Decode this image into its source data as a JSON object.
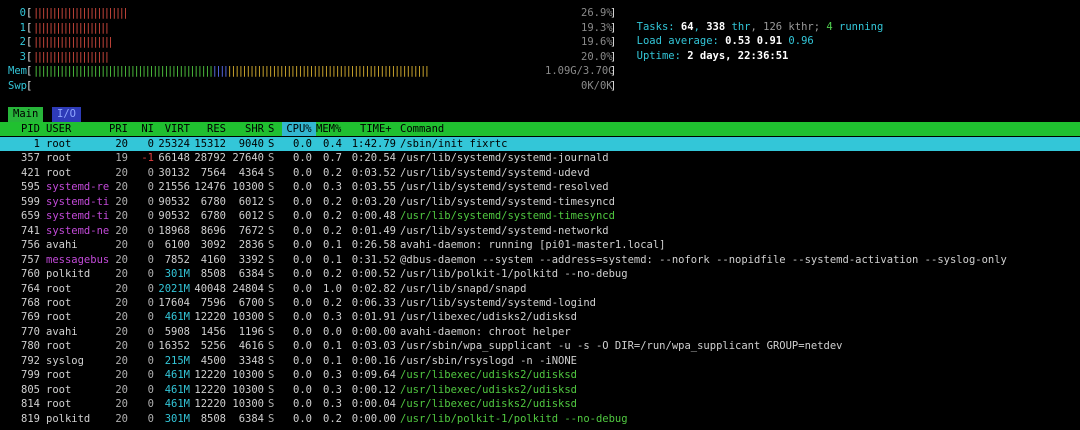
{
  "cpus": [
    {
      "label": "0",
      "bar_red": "|||||||||||||||||||||||||",
      "bar_green": "",
      "pct": "26.9%"
    },
    {
      "label": "1",
      "bar_red": "||||||||||||||||||||",
      "bar_green": "",
      "pct": "19.3%"
    },
    {
      "label": "2",
      "bar_red": "|||||||||||||||||||||",
      "bar_green": "",
      "pct": "19.6%"
    },
    {
      "label": "3",
      "bar_red": "||||||||||||||||||||",
      "bar_green": "",
      "pct": "20.0%"
    }
  ],
  "mem": {
    "label": "Mem",
    "bar_green": "||||||||||||||||||||||||||||||||||||||||||||||||",
    "bar_blue": "||||",
    "bar_yellow": "||||||||||||||||||||||||||||||||||||||||||||||||||||||",
    "value": "1.09G/3.70G"
  },
  "swp": {
    "label": "Swp",
    "value": "0K/0K"
  },
  "summary": {
    "tasks_label": "Tasks: ",
    "tasks": "64",
    "sep1": ", ",
    "thr": "338",
    "thr_label": " thr",
    "kthr": ", 126 kthr; ",
    "running": "4",
    "running_label": " running",
    "load_label": "Load average: ",
    "load1": "0.53",
    "load5": "0.91",
    "load15": "0.96",
    "uptime_label": "Uptime: ",
    "uptime": "2 days, 22:36:51"
  },
  "tabs": {
    "main": "Main",
    "io": "I/O"
  },
  "columns": {
    "pid": "PID",
    "user": "USER",
    "pri": "PRI",
    "ni": "NI",
    "virt": "VIRT",
    "res": "RES",
    "shr": "SHR",
    "s": "S",
    "cpu": "CPU%",
    "mem": "MEM%",
    "time": "TIME+",
    "command": "Command"
  },
  "processes": [
    {
      "pid": "1",
      "user": "root",
      "pri": "20",
      "ni": "0",
      "virt": "25324",
      "res": "15312",
      "shr": "9040",
      "s": "S",
      "cpu": "0.0",
      "mem": "0.4",
      "time": "1:42.79",
      "command": "/sbin/init fixrtc",
      "selected": true
    },
    {
      "pid": "357",
      "user": "root",
      "pri": "19",
      "ni": "-1",
      "virt": "66148",
      "res": "28792",
      "shr": "27640",
      "s": "S",
      "cpu": "0.0",
      "mem": "0.7",
      "time": "0:20.54",
      "command": "/usr/lib/systemd/systemd-journald"
    },
    {
      "pid": "421",
      "user": "root",
      "pri": "20",
      "ni": "0",
      "virt": "30132",
      "res": "7564",
      "shr": "4364",
      "s": "S",
      "cpu": "0.0",
      "mem": "0.2",
      "time": "0:03.52",
      "command": "/usr/lib/systemd/systemd-udevd"
    },
    {
      "pid": "595",
      "user": "systemd-re",
      "pri": "20",
      "ni": "0",
      "virt": "21556",
      "res": "12476",
      "shr": "10300",
      "s": "S",
      "cpu": "0.0",
      "mem": "0.3",
      "time": "0:03.55",
      "command": "/usr/lib/systemd/systemd-resolved",
      "mag": true
    },
    {
      "pid": "599",
      "user": "systemd-ti",
      "pri": "20",
      "ni": "0",
      "virt": "90532",
      "res": "6780",
      "shr": "6012",
      "s": "S",
      "cpu": "0.0",
      "mem": "0.2",
      "time": "0:03.20",
      "command": "/usr/lib/systemd/systemd-timesyncd",
      "mag": true
    },
    {
      "pid": "659",
      "user": "systemd-ti",
      "pri": "20",
      "ni": "0",
      "virt": "90532",
      "res": "6780",
      "shr": "6012",
      "s": "S",
      "cpu": "0.0",
      "mem": "0.2",
      "time": "0:00.48",
      "command": "/usr/lib/systemd/systemd-timesyncd",
      "mag": true,
      "green": true
    },
    {
      "pid": "741",
      "user": "systemd-ne",
      "pri": "20",
      "ni": "0",
      "virt": "18968",
      "res": "8696",
      "shr": "7672",
      "s": "S",
      "cpu": "0.0",
      "mem": "0.2",
      "time": "0:01.49",
      "command": "/usr/lib/systemd/systemd-networkd",
      "mag": true
    },
    {
      "pid": "756",
      "user": "avahi",
      "pri": "20",
      "ni": "0",
      "virt": "6100",
      "res": "3092",
      "shr": "2836",
      "s": "S",
      "cpu": "0.0",
      "mem": "0.1",
      "time": "0:26.58",
      "command": "avahi-daemon: running [pi01-master1.local]"
    },
    {
      "pid": "757",
      "user": "messagebus",
      "pri": "20",
      "ni": "0",
      "virt": "7852",
      "res": "4160",
      "shr": "3392",
      "s": "S",
      "cpu": "0.0",
      "mem": "0.1",
      "time": "0:31.52",
      "command": "@dbus-daemon --system --address=systemd: --nofork --nopidfile --systemd-activation --syslog-only",
      "mag": true
    },
    {
      "pid": "760",
      "user": "polkitd",
      "pri": "20",
      "ni": "0",
      "virt": "301M",
      "res": "8508",
      "shr": "6384",
      "s": "S",
      "cpu": "0.0",
      "mem": "0.2",
      "time": "0:00.52",
      "command": "/usr/lib/polkit-1/polkitd --no-debug"
    },
    {
      "pid": "764",
      "user": "root",
      "pri": "20",
      "ni": "0",
      "virt": "2021M",
      "res": "40048",
      "shr": "24804",
      "s": "S",
      "cpu": "0.0",
      "mem": "1.0",
      "time": "0:02.82",
      "command": "/usr/lib/snapd/snapd"
    },
    {
      "pid": "768",
      "user": "root",
      "pri": "20",
      "ni": "0",
      "virt": "17604",
      "res": "7596",
      "shr": "6700",
      "s": "S",
      "cpu": "0.0",
      "mem": "0.2",
      "time": "0:06.33",
      "command": "/usr/lib/systemd/systemd-logind"
    },
    {
      "pid": "769",
      "user": "root",
      "pri": "20",
      "ni": "0",
      "virt": "461M",
      "res": "12220",
      "shr": "10300",
      "s": "S",
      "cpu": "0.0",
      "mem": "0.3",
      "time": "0:01.91",
      "command": "/usr/libexec/udisks2/udisksd"
    },
    {
      "pid": "770",
      "user": "avahi",
      "pri": "20",
      "ni": "0",
      "virt": "5908",
      "res": "1456",
      "shr": "1196",
      "s": "S",
      "cpu": "0.0",
      "mem": "0.0",
      "time": "0:00.00",
      "command": "avahi-daemon: chroot helper"
    },
    {
      "pid": "780",
      "user": "root",
      "pri": "20",
      "ni": "0",
      "virt": "16352",
      "res": "5256",
      "shr": "4616",
      "s": "S",
      "cpu": "0.0",
      "mem": "0.1",
      "time": "0:03.03",
      "command": "/usr/sbin/wpa_supplicant -u -s -O DIR=/run/wpa_supplicant GROUP=netdev"
    },
    {
      "pid": "792",
      "user": "syslog",
      "pri": "20",
      "ni": "0",
      "virt": "215M",
      "res": "4500",
      "shr": "3348",
      "s": "S",
      "cpu": "0.0",
      "mem": "0.1",
      "time": "0:00.16",
      "command": "/usr/sbin/rsyslogd -n -iNONE"
    },
    {
      "pid": "799",
      "user": "root",
      "pri": "20",
      "ni": "0",
      "virt": "461M",
      "res": "12220",
      "shr": "10300",
      "s": "S",
      "cpu": "0.0",
      "mem": "0.3",
      "time": "0:09.64",
      "command": "/usr/libexec/udisks2/udisksd",
      "green": true
    },
    {
      "pid": "805",
      "user": "root",
      "pri": "20",
      "ni": "0",
      "virt": "461M",
      "res": "12220",
      "shr": "10300",
      "s": "S",
      "cpu": "0.0",
      "mem": "0.3",
      "time": "0:00.12",
      "command": "/usr/libexec/udisks2/udisksd",
      "green": true
    },
    {
      "pid": "814",
      "user": "root",
      "pri": "20",
      "ni": "0",
      "virt": "461M",
      "res": "12220",
      "shr": "10300",
      "s": "S",
      "cpu": "0.0",
      "mem": "0.3",
      "time": "0:00.04",
      "command": "/usr/libexec/udisks2/udisksd",
      "green": true
    },
    {
      "pid": "819",
      "user": "polkitd",
      "pri": "20",
      "ni": "0",
      "virt": "301M",
      "res": "8508",
      "shr": "6384",
      "s": "S",
      "cpu": "0.0",
      "mem": "0.2",
      "time": "0:00.00",
      "command": "/usr/lib/polkit-1/polkitd --no-debug",
      "green": true
    }
  ],
  "colors": {
    "accent_cyan": "#33c6d8",
    "header_green": "#20c030",
    "bar_red": "#d24a3e",
    "user_magenta": "#c24ad8",
    "thread_green": "#50c840"
  }
}
